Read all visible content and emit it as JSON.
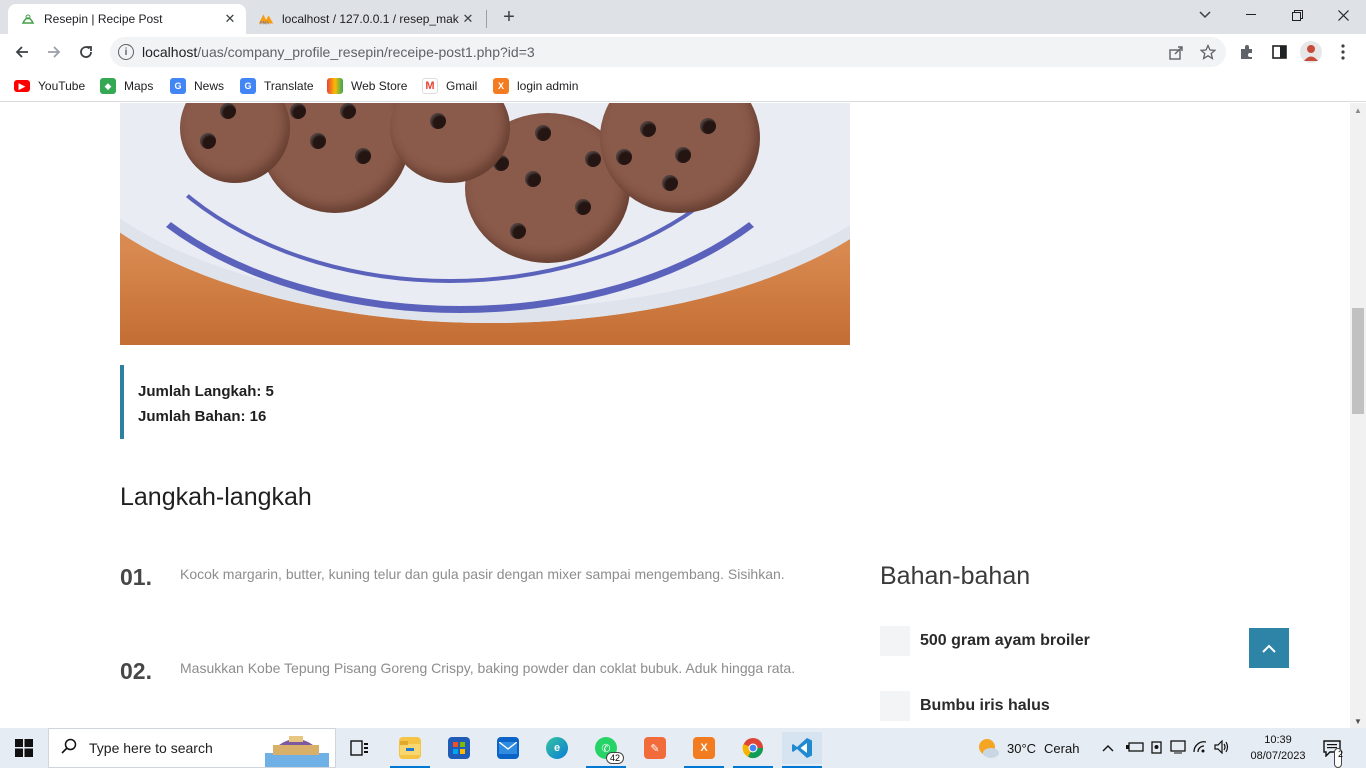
{
  "browser": {
    "tabs": [
      {
        "title": "Resepin | Recipe Post",
        "active": true
      },
      {
        "title": "localhost / 127.0.0.1 / resep_mak",
        "active": false
      }
    ],
    "url_host": "localhost",
    "url_path": "/uas/company_profile_resepin/receipe-post1.php?id=3",
    "bookmarks": [
      {
        "label": "YouTube",
        "icon": "youtube-icon",
        "color": "#ff0000"
      },
      {
        "label": "Maps",
        "icon": "maps-icon",
        "color": "#34a853"
      },
      {
        "label": "News",
        "icon": "news-icon",
        "color": "#4285f4"
      },
      {
        "label": "Translate",
        "icon": "translate-icon",
        "color": "#4285f4"
      },
      {
        "label": "Web Store",
        "icon": "webstore-icon",
        "color": "#ea4335"
      },
      {
        "label": "Gmail",
        "icon": "gmail-icon",
        "color": "#ea4335"
      },
      {
        "label": "login admin",
        "icon": "xampp-icon",
        "color": "#f37c20"
      }
    ]
  },
  "page": {
    "summary": {
      "steps_count": "Jumlah Langkah: 5",
      "ingredients_count": "Jumlah Bahan: 16"
    },
    "steps_heading": "Langkah-langkah",
    "steps": [
      {
        "num": "01.",
        "text": "Kocok margarin, butter, kuning telur dan gula pasir dengan mixer sampai mengembang. Sisihkan."
      },
      {
        "num": "02.",
        "text": "Masukkan Kobe Tepung Pisang Goreng Crispy, baking powder dan coklat bubuk. Aduk hingga rata."
      }
    ],
    "ingredients_heading": "Bahan-bahan",
    "ingredients": [
      {
        "label": "500 gram ayam broiler"
      },
      {
        "label": "Bumbu iris halus"
      }
    ],
    "accent_color": "#2e84a6"
  },
  "taskbar": {
    "search_placeholder": "Type here to search",
    "weather_temp": "30°C",
    "weather_desc": "Cerah",
    "time": "10:39",
    "date": "08/07/2023",
    "whatsapp_badge": "42",
    "notification_badge": "2"
  }
}
